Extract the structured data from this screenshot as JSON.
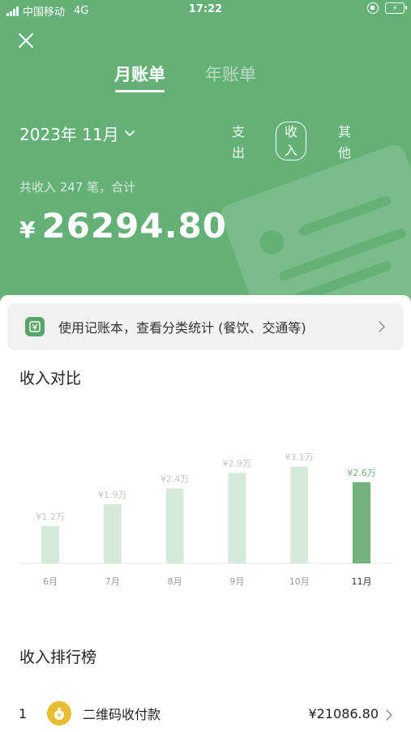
{
  "status_bar": {
    "carrier": "中国移动",
    "network": "4G",
    "time": "17:22"
  },
  "tabs": [
    {
      "label": "月账单",
      "active": true
    },
    {
      "label": "年账单",
      "active": false
    }
  ],
  "period": {
    "label": "2023年 11月"
  },
  "filters": {
    "expense": "支出",
    "income": "收入",
    "other": "其他",
    "selected": "收入"
  },
  "summary": {
    "label": "共收入 247 笔，合计",
    "currency": "¥",
    "amount": "26294.80"
  },
  "banner": {
    "text": "使用记账本，查看分类统计 (餐饮、交通等)"
  },
  "comparison": {
    "title": "收入对比"
  },
  "chart_data": {
    "type": "bar",
    "categories": [
      "6月",
      "7月",
      "8月",
      "9月",
      "10月",
      "11月"
    ],
    "values": [
      1.2,
      1.9,
      2.4,
      2.9,
      3.1,
      2.6
    ],
    "data_labels": [
      "¥1.2万",
      "¥1.9万",
      "¥2.4万",
      "¥2.9万",
      "¥3.1万",
      "¥2.6万"
    ],
    "highlight_index": 5,
    "ylim": [
      0,
      3.4
    ],
    "colors": {
      "bar": "#d6eadb",
      "highlight": "#72b27f",
      "label": "#c5c5c5",
      "highlight_label": "#72b27f"
    }
  },
  "ranking": {
    "title": "收入排行榜",
    "items": [
      {
        "rank": "1",
        "name": "二维码收付款",
        "amount": "¥21086.80",
        "icon": "coin-bag-icon"
      }
    ]
  },
  "colors": {
    "header_bg": "#64b077",
    "accent": "#72b27f",
    "rank_icon_bg": "#e9bd2f"
  }
}
